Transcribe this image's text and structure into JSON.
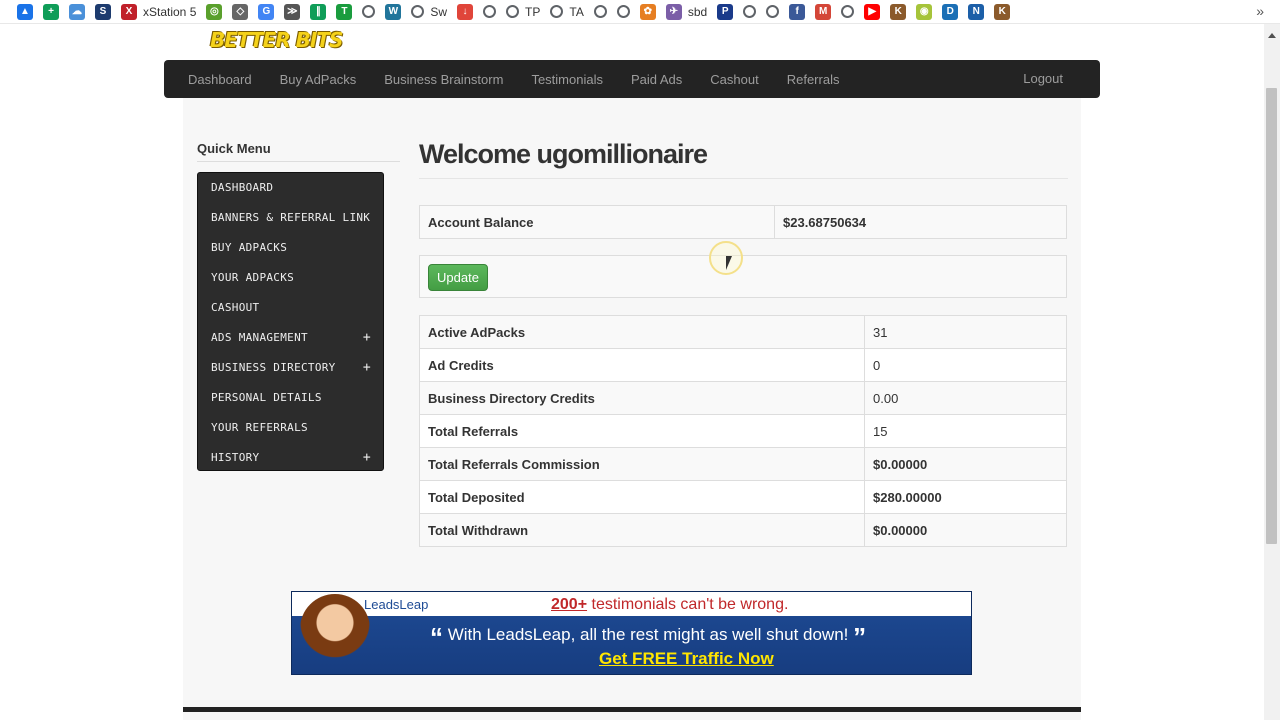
{
  "bookmarks": [
    {
      "name": "drive-icon",
      "label": "",
      "color": "#1a73e8",
      "glyph": "▲"
    },
    {
      "name": "sheets-icon",
      "label": "",
      "color": "#0f9d58",
      "glyph": "+"
    },
    {
      "name": "cloud-icon",
      "label": "",
      "color": "#4a90d9",
      "glyph": "☁"
    },
    {
      "name": "sdo-icon",
      "label": "",
      "color": "#1d3b6e",
      "glyph": "S"
    },
    {
      "name": "xstation-icon",
      "label": "xStation 5",
      "color": "#c0202a",
      "glyph": "X"
    },
    {
      "name": "leaf-icon",
      "label": "",
      "color": "#5aa02c",
      "glyph": "◎"
    },
    {
      "name": "layers-icon",
      "label": "",
      "color": "#666666",
      "glyph": "◇"
    },
    {
      "name": "google-icon",
      "label": "",
      "color": "#4285f4",
      "glyph": "G"
    },
    {
      "name": "rocket-icon",
      "label": "",
      "color": "#555555",
      "glyph": "≫"
    },
    {
      "name": "bars-icon",
      "label": "",
      "color": "#0f9d58",
      "glyph": "∥"
    },
    {
      "name": "t-icon",
      "label": "",
      "color": "#1a9c3e",
      "glyph": "T"
    },
    {
      "name": "globe-icon",
      "label": "",
      "color": "",
      "glyph": ""
    },
    {
      "name": "wordpress-icon",
      "label": "",
      "color": "#21759b",
      "glyph": "W"
    },
    {
      "name": "sw-icon",
      "label": "Sw",
      "color": "",
      "glyph": ""
    },
    {
      "name": "download-icon",
      "label": "",
      "color": "#e0453a",
      "glyph": "↓"
    },
    {
      "name": "globe-icon",
      "label": "",
      "color": "",
      "glyph": ""
    },
    {
      "name": "globe-icon",
      "label": "TP",
      "color": "",
      "glyph": ""
    },
    {
      "name": "globe-icon",
      "label": "TA",
      "color": "",
      "glyph": ""
    },
    {
      "name": "globe-icon",
      "label": "",
      "color": "",
      "glyph": ""
    },
    {
      "name": "globe-icon",
      "label": "",
      "color": "",
      "glyph": ""
    },
    {
      "name": "flower-icon",
      "label": "",
      "color": "#e67e22",
      "glyph": "✿"
    },
    {
      "name": "sbd-icon",
      "label": "sbd",
      "color": "#7b5ea7",
      "glyph": "✈"
    },
    {
      "name": "pp-icon",
      "label": "",
      "color": "#1a3a8a",
      "glyph": "P"
    },
    {
      "name": "globe-icon",
      "label": "",
      "color": "",
      "glyph": ""
    },
    {
      "name": "globe-icon",
      "label": "",
      "color": "",
      "glyph": ""
    },
    {
      "name": "facebook-icon",
      "label": "",
      "color": "#3b5998",
      "glyph": "f"
    },
    {
      "name": "gmail-icon",
      "label": "",
      "color": "#d44638",
      "glyph": "M"
    },
    {
      "name": "globe-icon",
      "label": "",
      "color": "",
      "glyph": ""
    },
    {
      "name": "youtube-icon",
      "label": "",
      "color": "#ff0000",
      "glyph": "▶"
    },
    {
      "name": "k-icon",
      "label": "",
      "color": "#8b5a2b",
      "glyph": "K"
    },
    {
      "name": "circle-icon",
      "label": "",
      "color": "#a6c43a",
      "glyph": "◉"
    },
    {
      "name": "d-icon",
      "label": "",
      "color": "#1b6fb5",
      "glyph": "D"
    },
    {
      "name": "n-icon",
      "label": "",
      "color": "#1c5fa8",
      "glyph": "N"
    },
    {
      "name": "k2-icon",
      "label": "",
      "color": "#8b5a2b",
      "glyph": "K"
    }
  ],
  "bookmarks_more": "»",
  "logo_text": "BETTER BITS",
  "nav": {
    "items": [
      "Dashboard",
      "Buy AdPacks",
      "Business Brainstorm",
      "Testimonials",
      "Paid Ads",
      "Cashout",
      "Referrals"
    ],
    "logout": "Logout"
  },
  "quick_menu": {
    "title": "Quick Menu",
    "items": [
      {
        "label": "DASHBOARD",
        "expand": ""
      },
      {
        "label": "BANNERS & REFERRAL LINK",
        "expand": ""
      },
      {
        "label": "BUY ADPACKS",
        "expand": ""
      },
      {
        "label": "YOUR ADPACKS",
        "expand": ""
      },
      {
        "label": "CASHOUT",
        "expand": ""
      },
      {
        "label": "ADS MANAGEMENT",
        "expand": "+"
      },
      {
        "label": "BUSINESS DIRECTORY",
        "expand": "+"
      },
      {
        "label": "PERSONAL DETAILS",
        "expand": ""
      },
      {
        "label": "YOUR REFERRALS",
        "expand": ""
      },
      {
        "label": "HISTORY",
        "expand": "+"
      }
    ]
  },
  "main": {
    "welcome": "Welcome ugomillionaire",
    "balance_label": "Account Balance",
    "balance_value": "$23.68750634",
    "update_label": "Update",
    "stats": [
      {
        "label": "Active AdPacks",
        "value": "31",
        "bold": false
      },
      {
        "label": "Ad Credits",
        "value": "0",
        "bold": false
      },
      {
        "label": "Business Directory Credits",
        "value": "0.00",
        "bold": false
      },
      {
        "label": "Total Referrals",
        "value": "15",
        "bold": false
      },
      {
        "label": "Total Referrals Commission",
        "value": "$0.00000",
        "bold": true
      },
      {
        "label": "Total Deposited",
        "value": "$280.00000",
        "bold": true
      },
      {
        "label": "Total Withdrawn",
        "value": "$0.00000",
        "bold": true
      }
    ]
  },
  "banner": {
    "brand": "LeadsLeap",
    "line1_num": "200+",
    "line1_rest": " testimonials can't be wrong.",
    "line2": "With LeadsLeap, all the rest might as well shut down!",
    "line3": "Get FREE Traffic Now"
  }
}
